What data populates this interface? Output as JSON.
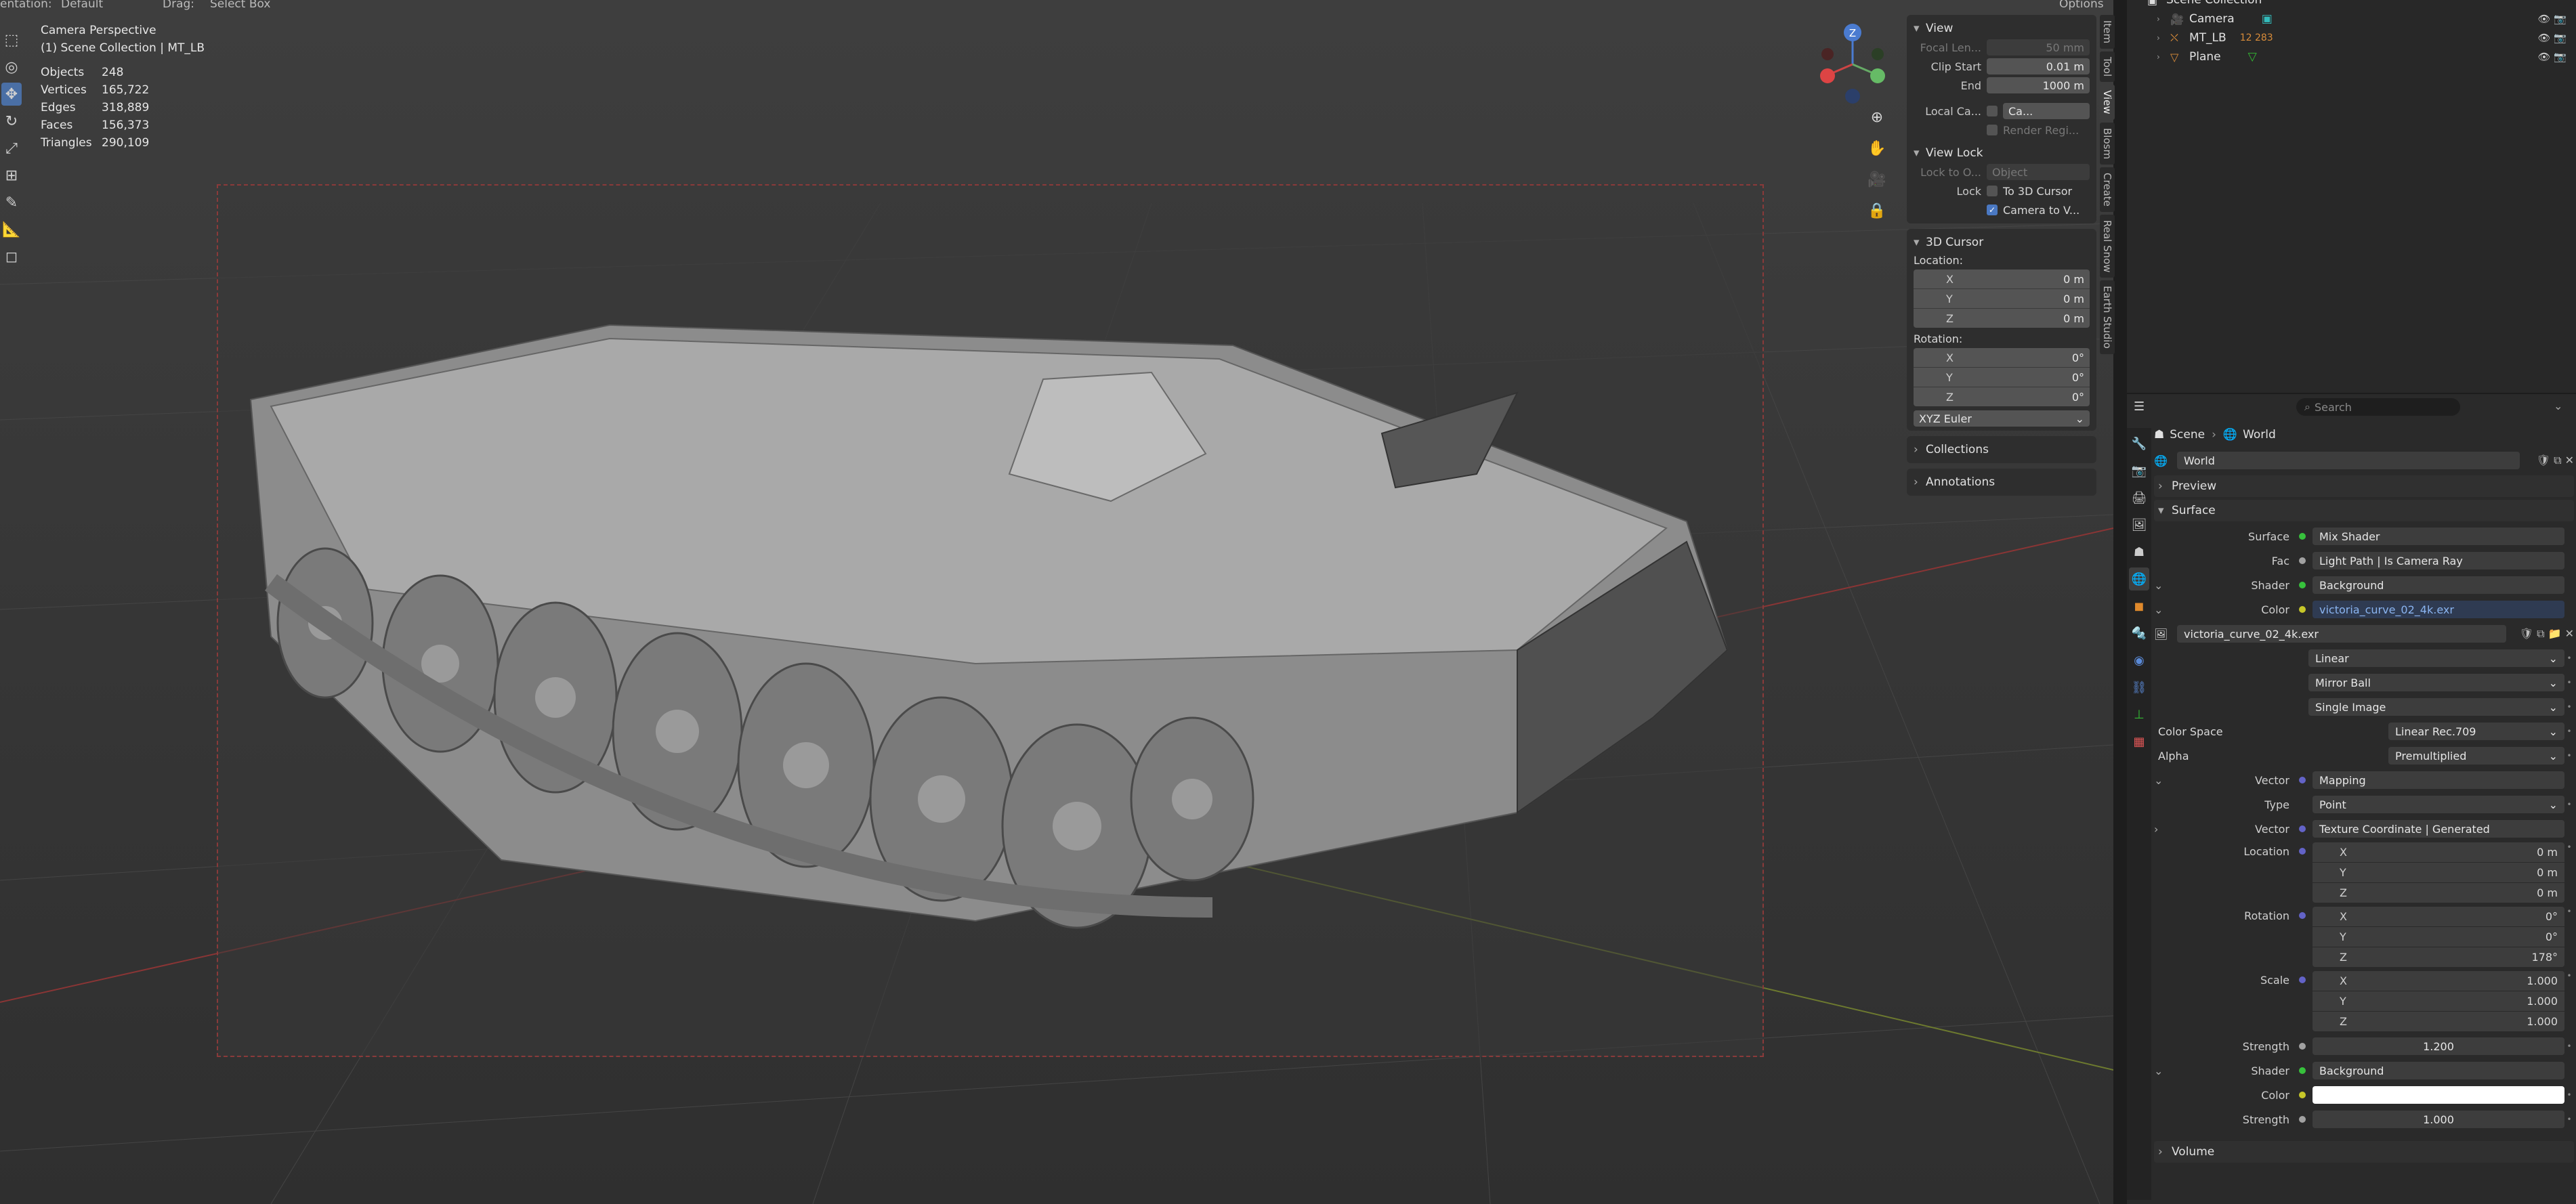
{
  "viewport": {
    "topbar": {
      "orientation_label": "entation:",
      "orientation_value": "Default",
      "drag_label": "Drag:",
      "drag_value": "Select Box",
      "options": "Options"
    },
    "overlay": {
      "title": "Camera Perspective",
      "collection": "(1) Scene Collection | MT_LB",
      "stats": [
        {
          "k": "Objects",
          "v": "248"
        },
        {
          "k": "Vertices",
          "v": "165,722"
        },
        {
          "k": "Edges",
          "v": "318,889"
        },
        {
          "k": "Faces",
          "v": "156,373"
        },
        {
          "k": "Triangles",
          "v": "290,109"
        }
      ]
    },
    "gizmo": {
      "z_label": "Z"
    }
  },
  "npanel": {
    "view": {
      "header": "View",
      "focal_label": "Focal Len...",
      "focal_value": "50 mm",
      "clip_start_label": "Clip Start",
      "clip_start_value": "0.01 m",
      "end_label": "End",
      "end_value": "1000 m",
      "local_camera_label": "Local Ca...",
      "local_camera_value": "Ca...",
      "render_region_label": "Render Regi..."
    },
    "view_lock": {
      "header": "View Lock",
      "lock_to_label": "Lock to O...",
      "lock_to_value": "Object",
      "lock_label": "Lock",
      "to_cursor": "To 3D Cursor",
      "camera_to_view": "Camera to V..."
    },
    "cursor": {
      "header": "3D Cursor",
      "location_label": "Location:",
      "location": [
        {
          "a": "X",
          "v": "0 m"
        },
        {
          "a": "Y",
          "v": "0 m"
        },
        {
          "a": "Z",
          "v": "0 m"
        }
      ],
      "rotation_label": "Rotation:",
      "rotation": [
        {
          "a": "X",
          "v": "0°"
        },
        {
          "a": "Y",
          "v": "0°"
        },
        {
          "a": "Z",
          "v": "0°"
        }
      ],
      "mode": "XYZ Euler"
    },
    "collections": "Collections",
    "annotations": "Annotations",
    "tabs": [
      "Item",
      "Tool",
      "View",
      "Blosm",
      "Create",
      "Real Snow",
      "Earth Studio"
    ]
  },
  "outliner": {
    "header": "Scene Collection",
    "items": [
      {
        "name": "Camera",
        "tail": ""
      },
      {
        "name": "MT_LB",
        "tail": "12 283"
      },
      {
        "name": "Plane",
        "tail": ""
      }
    ]
  },
  "properties": {
    "search_placeholder": "Search",
    "breadcrumb": {
      "scene": "Scene",
      "world": "World"
    },
    "world_name": "World",
    "sections": {
      "preview": "Preview",
      "surface": "Surface",
      "volume": "Volume"
    },
    "surface": {
      "surface_label": "Surface",
      "surface_value": "Mix Shader",
      "fac_label": "Fac",
      "fac_value": "Light Path | Is Camera Ray",
      "shader_label": "Shader",
      "shader_value": "Background",
      "color_label": "Color",
      "color_value": "victoria_curve_02_4k.exr",
      "image_name": "victoria_curve_02_4k.exr",
      "interp": "Linear",
      "projection": "Mirror Ball",
      "source": "Single Image",
      "colorspace_label": "Color Space",
      "colorspace_value": "Linear Rec.709",
      "alpha_label": "Alpha",
      "alpha_value": "Premultiplied",
      "vector_label": "Vector",
      "vector_value": "Mapping",
      "type_label": "Type",
      "type_value": "Point",
      "vector2_label": "Vector",
      "vector2_value": "Texture Coordinate | Generated",
      "location_label": "Location",
      "location": [
        {
          "a": "X",
          "v": "0 m"
        },
        {
          "a": "Y",
          "v": "0 m"
        },
        {
          "a": "Z",
          "v": "0 m"
        }
      ],
      "rotation_label": "Rotation",
      "rotation": [
        {
          "a": "X",
          "v": "0°"
        },
        {
          "a": "Y",
          "v": "0°"
        },
        {
          "a": "Z",
          "v": "178°"
        }
      ],
      "scale_label": "Scale",
      "scale": [
        {
          "a": "X",
          "v": "1.000"
        },
        {
          "a": "Y",
          "v": "1.000"
        },
        {
          "a": "Z",
          "v": "1.000"
        }
      ],
      "strength_label": "Strength",
      "strength_value": "1.200",
      "shader2_label": "Shader",
      "shader2_value": "Background",
      "color2_label": "Color",
      "strength2_label": "Strength",
      "strength2_value": "1.000"
    }
  },
  "colors": {
    "accent": "#4a78c2",
    "socket_yellow": "#c7c729",
    "socket_green": "#37c13c",
    "socket_purple": "#6363c7",
    "socket_gray": "#a1a1a1"
  }
}
